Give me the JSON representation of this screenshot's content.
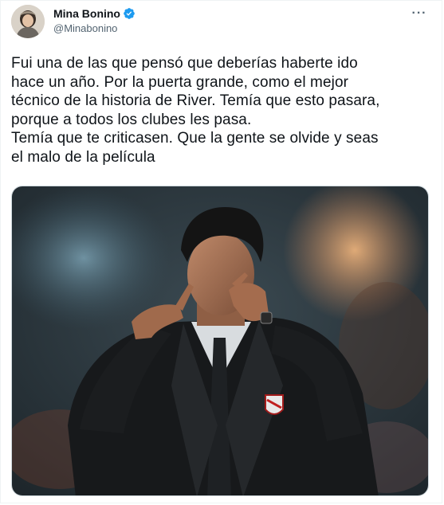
{
  "author": {
    "display_name": "Mina Bonino",
    "handle": "@Minabonino",
    "verified": true,
    "avatar_icon": "profile-photo"
  },
  "menu": {
    "icon": "more-horizontal-icon",
    "glyph": "···"
  },
  "tweet": {
    "text": "Fui una de las que pensó que deberías haberte ido\nhace un año. Por la puerta grande, como el mejor\ntécnico de la historia de River. Temía que esto pasara,\nporque a todos los clubes les pasa.\nTemía que te criticasen. Que la gente se olvide y seas\nel malo de la película"
  },
  "media": {
    "type": "photo",
    "description_icon": "photo-of-coach-in-dark-suit"
  },
  "colors": {
    "text": "#0f1419",
    "secondary": "#536471",
    "verified_blue": "#1d9bf0",
    "border": "#cfd9de"
  }
}
